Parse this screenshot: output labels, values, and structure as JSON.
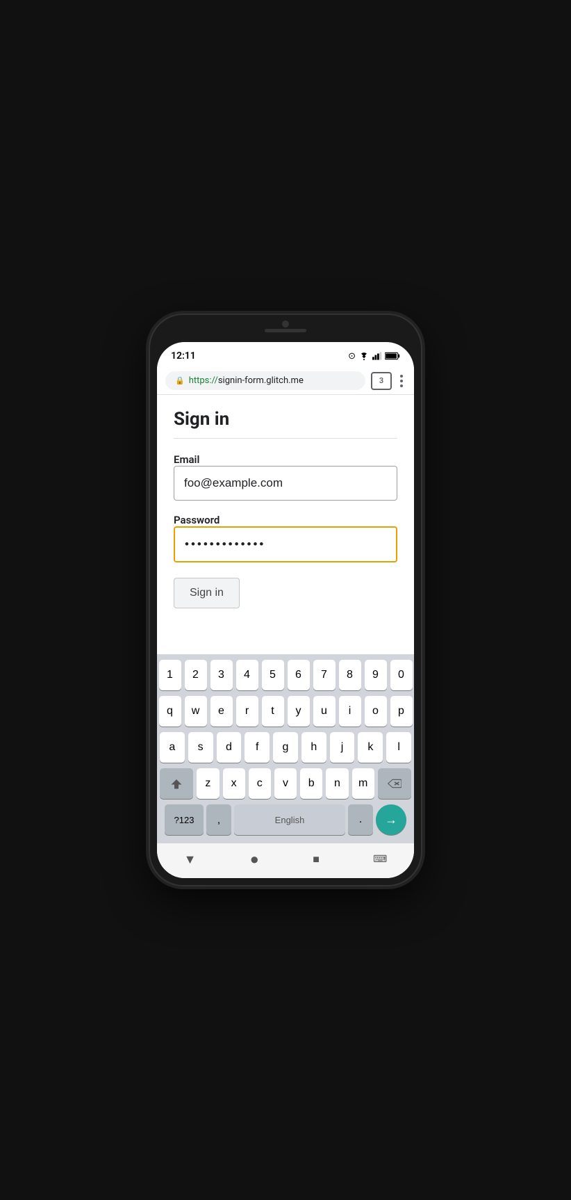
{
  "status_bar": {
    "time": "12:11",
    "tab_count": "3"
  },
  "address_bar": {
    "url_protocol": "https://",
    "url_domain": "signin-form.glitch.me"
  },
  "page": {
    "title": "Sign in",
    "email_label": "Email",
    "email_value": "foo@example.com",
    "password_label": "Password",
    "password_value": "••••••••••••",
    "signin_button_label": "Sign in"
  },
  "keyboard": {
    "row1": [
      "1",
      "2",
      "3",
      "4",
      "5",
      "6",
      "7",
      "8",
      "9",
      "0"
    ],
    "row2": [
      "q",
      "w",
      "e",
      "r",
      "t",
      "y",
      "u",
      "i",
      "o",
      "p"
    ],
    "row3": [
      "a",
      "s",
      "d",
      "f",
      "g",
      "h",
      "j",
      "k",
      "l"
    ],
    "row4": [
      "z",
      "x",
      "c",
      "v",
      "b",
      "n",
      "m"
    ],
    "numbers_label": "?123",
    "comma": ",",
    "space_label": "English",
    "period": ".",
    "enter_arrow": "→"
  },
  "nav_bar": {
    "back_icon": "▼",
    "home_icon": "●",
    "recents_icon": "■",
    "keyboard_icon": "⌨"
  },
  "colors": {
    "password_border": "#e8a000",
    "lock_color": "#1a7f37",
    "enter_key_bg": "#26a69a",
    "https_color": "#1a7f37"
  }
}
